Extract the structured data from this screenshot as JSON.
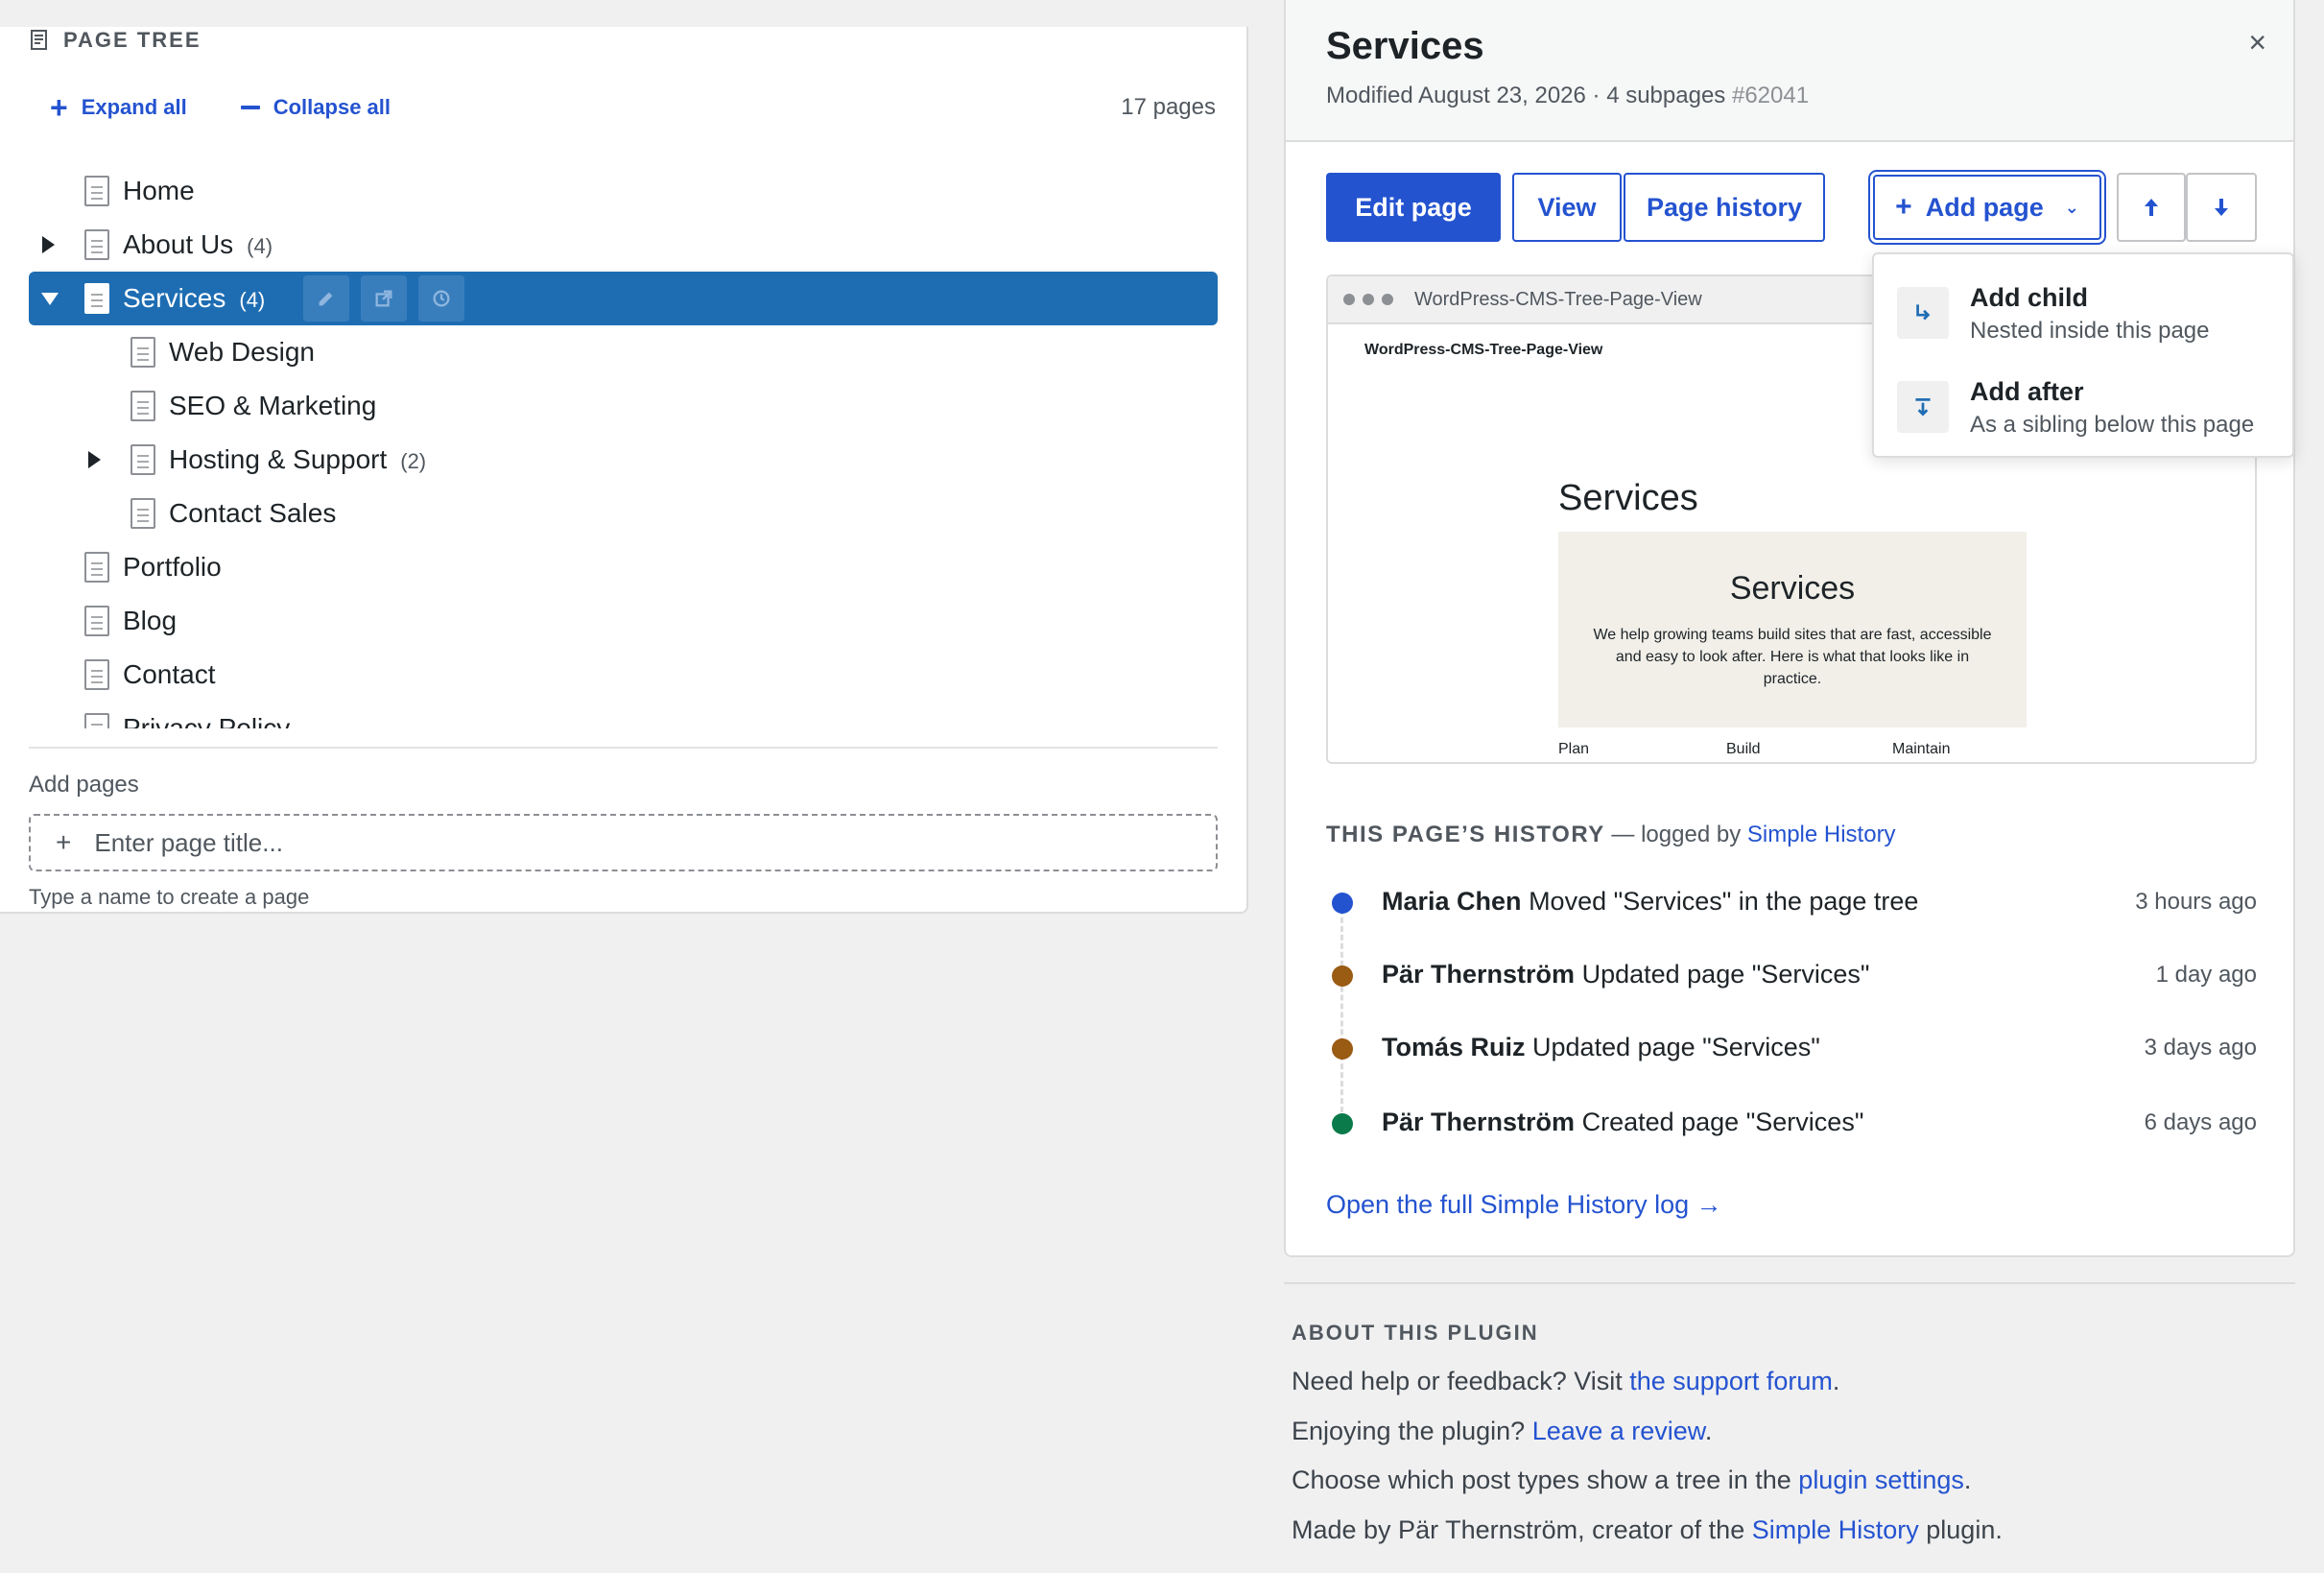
{
  "tree": {
    "title": "PAGE TREE",
    "expand_all": "Expand all",
    "collapse_all": "Collapse all",
    "page_count": "17 pages",
    "rows": [
      {
        "label": "Home",
        "count": ""
      },
      {
        "label": "About Us",
        "count": "(4)"
      },
      {
        "label": "Services",
        "count": "(4)"
      },
      {
        "label": "Web Design",
        "count": ""
      },
      {
        "label": "SEO & Marketing",
        "count": ""
      },
      {
        "label": "Hosting & Support",
        "count": "(2)"
      },
      {
        "label": "Contact Sales",
        "count": ""
      },
      {
        "label": "Portfolio",
        "count": ""
      },
      {
        "label": "Blog",
        "count": ""
      },
      {
        "label": "Contact",
        "count": ""
      },
      {
        "label": "Privacy Policy",
        "count": ""
      }
    ],
    "add_pages_label": "Add pages",
    "add_placeholder": "Enter page title...",
    "add_help": "Type a name to create a page"
  },
  "detail": {
    "title": "Services",
    "meta": "Modified August 23, 2026 · 4 subpages",
    "page_id": "#62041",
    "close": "×",
    "buttons": {
      "edit": "Edit page",
      "view": "View",
      "history": "Page history",
      "add": "Add page"
    },
    "preview": {
      "bar_url": "WordPress-CMS-Tree-Page-View",
      "site_name": "WordPress-CMS-Tree-Page-View",
      "heading": "Services",
      "hero_title": "Services",
      "hero_desc": "We help growing teams build sites that are fast, accessible and easy to look after. Here is what that looks like in practice.",
      "nav": [
        "Plan",
        "Build",
        "Maintain"
      ]
    },
    "add_menu": [
      {
        "title": "Add child",
        "desc": "Nested inside this page"
      },
      {
        "title": "Add after",
        "desc": "As a sibling below this page"
      }
    ],
    "history": {
      "heading_caps": "THIS PAGE’S HISTORY",
      "heading_rest": " — logged by ",
      "heading_link": "Simple History",
      "entries": [
        {
          "user": "Maria Chen",
          "action": "Moved \"Services\" in the page tree",
          "time": "3 hours ago",
          "color": "#2453d0"
        },
        {
          "user": "Pär Thernström",
          "action": "Updated page \"Services\"",
          "time": "1 day ago",
          "color": "#9a5b13"
        },
        {
          "user": "Tomás Ruiz",
          "action": "Updated page \"Services\"",
          "time": "3 days ago",
          "color": "#9a5b13"
        },
        {
          "user": "Pär Thernström",
          "action": "Created page \"Services\"",
          "time": "6 days ago",
          "color": "#0a7a4a"
        }
      ],
      "full_log_link": "Open the full Simple History log →"
    }
  },
  "about": {
    "title": "ABOUT THIS PLUGIN",
    "l1_text": "Need help or feedback? Visit ",
    "l1_link": "the support forum",
    "l1_end": ".",
    "l2_text": "Enjoying the plugin? ",
    "l2_link": "Leave a review",
    "l2_end": ".",
    "l3_text": "Choose which post types show a tree in the ",
    "l3_link": "plugin settings",
    "l3_end": ".",
    "l4_text": "Made by Pär Thernström, creator of the ",
    "l4_link": "Simple History",
    "l4_end": " plugin."
  }
}
